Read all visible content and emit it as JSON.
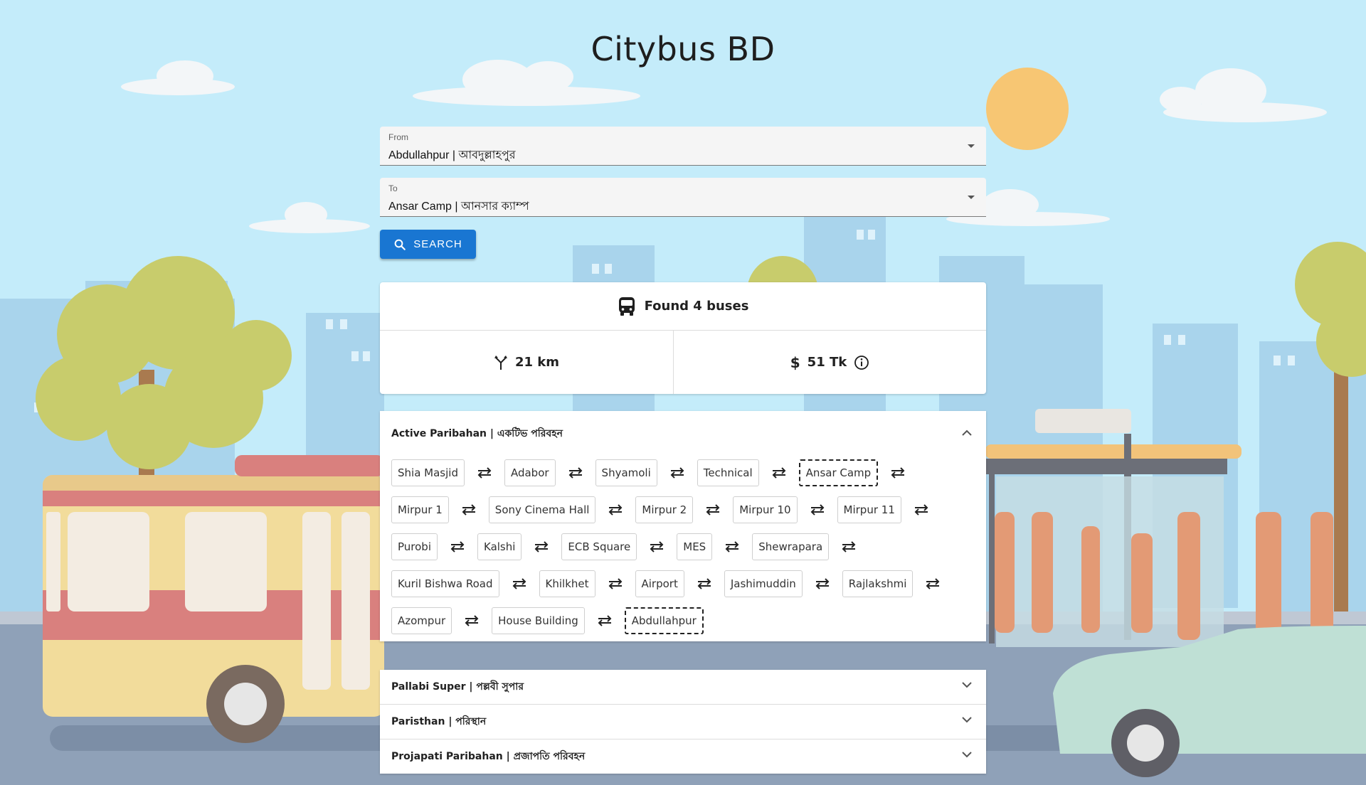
{
  "app": {
    "title": "Citybus BD"
  },
  "form": {
    "from": {
      "label": "From",
      "value": "Abdullahpur | আবদুল্লাহপুর"
    },
    "to": {
      "label": "To",
      "value": "Ansar Camp | আনসার ক্যাম্প"
    },
    "search_label": "SEARCH"
  },
  "summary": {
    "found": "Found 4 buses",
    "distance": "21 km",
    "fare": "51 Tk"
  },
  "buses": [
    {
      "name": "Active Paribahan | একটিভ পরিবহন",
      "expanded": true,
      "stops": [
        {
          "name": "Shia Masjid",
          "endpoint": false
        },
        {
          "name": "Adabor",
          "endpoint": false
        },
        {
          "name": "Shyamoli",
          "endpoint": false
        },
        {
          "name": "Technical",
          "endpoint": false
        },
        {
          "name": "Ansar Camp",
          "endpoint": true
        },
        {
          "name": "Mirpur 1",
          "endpoint": false
        },
        {
          "name": "Sony Cinema Hall",
          "endpoint": false
        },
        {
          "name": "Mirpur 2",
          "endpoint": false
        },
        {
          "name": "Mirpur 10",
          "endpoint": false
        },
        {
          "name": "Mirpur 11",
          "endpoint": false
        },
        {
          "name": "Purobi",
          "endpoint": false
        },
        {
          "name": "Kalshi",
          "endpoint": false
        },
        {
          "name": "ECB Square",
          "endpoint": false
        },
        {
          "name": "MES",
          "endpoint": false
        },
        {
          "name": "Shewrapara",
          "endpoint": false
        },
        {
          "name": "Kuril Bishwa Road",
          "endpoint": false
        },
        {
          "name": "Khilkhet",
          "endpoint": false
        },
        {
          "name": "Airport",
          "endpoint": false
        },
        {
          "name": "Jashimuddin",
          "endpoint": false
        },
        {
          "name": "Rajlakshmi",
          "endpoint": false
        },
        {
          "name": "Azompur",
          "endpoint": false
        },
        {
          "name": "House Building",
          "endpoint": false
        },
        {
          "name": "Abdullahpur",
          "endpoint": true
        }
      ]
    },
    {
      "name": "Pallabi Super | পল্লবী সুপার",
      "expanded": false
    },
    {
      "name": "Paristhan | পরিস্থান",
      "expanded": false
    },
    {
      "name": "Projapati Paribahan | প্রজাপতি পরিবহন",
      "expanded": false
    }
  ],
  "icons": {
    "search": "search-icon",
    "bus": "bus-icon",
    "distance": "route-fork-icon",
    "fare": "dollar-icon",
    "info": "info-icon",
    "expand": "chevron-down-icon",
    "collapse": "chevron-up-icon",
    "swap": "swap-arrows-icon"
  },
  "colors": {
    "primary": "#1976d2",
    "sky": "#c4ecfa"
  }
}
